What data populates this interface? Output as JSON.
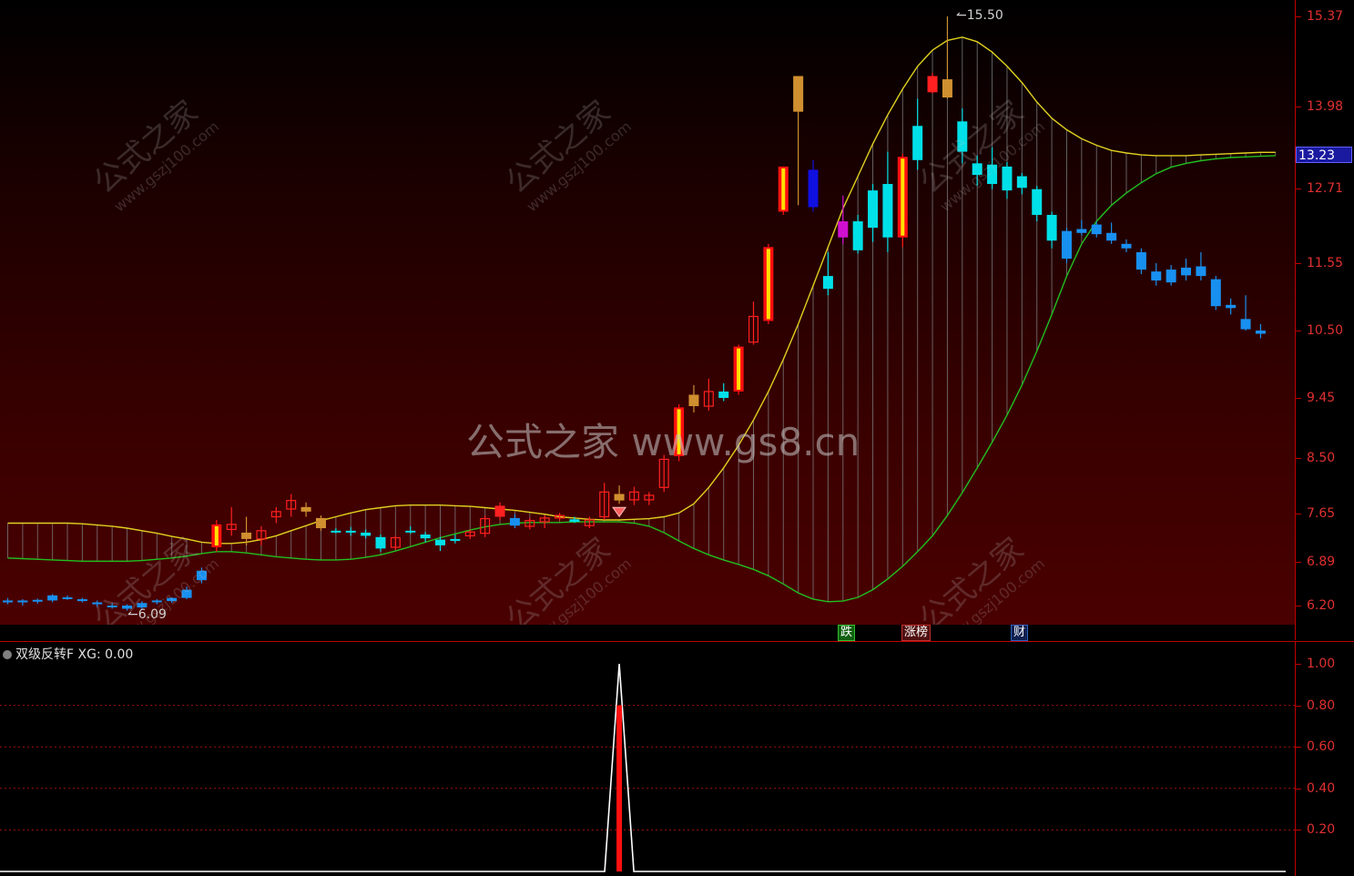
{
  "chart_data": [
    {
      "type": "candlestick",
      "title": "",
      "ylim": [
        6.0,
        15.6
      ],
      "y_ticks": [
        15.37,
        13.98,
        12.71,
        11.55,
        10.5,
        9.45,
        8.5,
        7.65,
        6.89,
        6.2
      ],
      "last_price_label": "13.23",
      "annotations": [
        {
          "text": "15.50",
          "kind": "high"
        },
        {
          "text": "6.09",
          "kind": "low"
        }
      ],
      "candles": [
        {
          "o": 6.28,
          "h": 6.32,
          "l": 6.22,
          "c": 6.25,
          "col": "blue"
        },
        {
          "o": 6.25,
          "h": 6.3,
          "l": 6.2,
          "c": 6.28,
          "col": "blue"
        },
        {
          "o": 6.27,
          "h": 6.31,
          "l": 6.23,
          "c": 6.29,
          "col": "blue"
        },
        {
          "o": 6.36,
          "h": 6.38,
          "l": 6.25,
          "c": 6.28,
          "col": "blue"
        },
        {
          "o": 6.33,
          "h": 6.36,
          "l": 6.29,
          "c": 6.32,
          "col": "blue"
        },
        {
          "o": 6.3,
          "h": 6.32,
          "l": 6.25,
          "c": 6.27,
          "col": "blue"
        },
        {
          "o": 6.25,
          "h": 6.28,
          "l": 6.18,
          "c": 6.22,
          "col": "blue"
        },
        {
          "o": 6.2,
          "h": 6.24,
          "l": 6.15,
          "c": 6.18,
          "col": "blue"
        },
        {
          "o": 6.2,
          "h": 6.22,
          "l": 6.12,
          "c": 6.15,
          "col": "blue"
        },
        {
          "o": 6.24,
          "h": 6.27,
          "l": 6.14,
          "c": 6.17,
          "col": "blue"
        },
        {
          "o": 6.26,
          "h": 6.3,
          "l": 6.22,
          "c": 6.28,
          "col": "blue"
        },
        {
          "o": 6.27,
          "h": 6.33,
          "l": 6.24,
          "c": 6.32,
          "col": "blue"
        },
        {
          "o": 6.45,
          "h": 6.5,
          "l": 6.3,
          "c": 6.32,
          "col": "blue"
        },
        {
          "o": 6.75,
          "h": 6.8,
          "l": 6.55,
          "c": 6.6,
          "col": "blue"
        },
        {
          "o": 7.12,
          "h": 7.55,
          "l": 7.05,
          "c": 7.48,
          "col": "limit"
        },
        {
          "o": 7.4,
          "h": 7.75,
          "l": 7.3,
          "c": 7.48,
          "col": "red"
        },
        {
          "o": 7.35,
          "h": 7.6,
          "l": 7.15,
          "c": 7.25,
          "col": "gold"
        },
        {
          "o": 7.25,
          "h": 7.45,
          "l": 7.15,
          "c": 7.38,
          "col": "red"
        },
        {
          "o": 7.6,
          "h": 7.75,
          "l": 7.5,
          "c": 7.68,
          "col": "red"
        },
        {
          "o": 7.72,
          "h": 7.95,
          "l": 7.6,
          "c": 7.85,
          "col": "red"
        },
        {
          "o": 7.75,
          "h": 7.82,
          "l": 7.6,
          "c": 7.68,
          "col": "gold"
        },
        {
          "o": 7.58,
          "h": 7.62,
          "l": 7.38,
          "c": 7.42,
          "col": "gold"
        },
        {
          "o": 7.38,
          "h": 7.42,
          "l": 7.34,
          "c": 7.37,
          "col": "cyan"
        },
        {
          "o": 7.38,
          "h": 7.44,
          "l": 7.3,
          "c": 7.35,
          "col": "cyan"
        },
        {
          "o": 7.35,
          "h": 7.4,
          "l": 7.26,
          "c": 7.3,
          "col": "cyan"
        },
        {
          "o": 7.28,
          "h": 7.32,
          "l": 7.05,
          "c": 7.1,
          "col": "cyan"
        },
        {
          "o": 7.12,
          "h": 7.3,
          "l": 7.08,
          "c": 7.27,
          "col": "red"
        },
        {
          "o": 7.38,
          "h": 7.45,
          "l": 7.33,
          "c": 7.36,
          "col": "cyan"
        },
        {
          "o": 7.32,
          "h": 7.36,
          "l": 7.2,
          "c": 7.26,
          "col": "cyan"
        },
        {
          "o": 7.24,
          "h": 7.28,
          "l": 7.06,
          "c": 7.15,
          "col": "cyan"
        },
        {
          "o": 7.25,
          "h": 7.32,
          "l": 7.18,
          "c": 7.22,
          "col": "cyan"
        },
        {
          "o": 7.3,
          "h": 7.4,
          "l": 7.25,
          "c": 7.36,
          "col": "red"
        },
        {
          "o": 7.34,
          "h": 7.62,
          "l": 7.28,
          "c": 7.57,
          "col": "red"
        },
        {
          "o": 7.6,
          "h": 7.82,
          "l": 7.55,
          "c": 7.77,
          "col": "redfill"
        },
        {
          "o": 7.58,
          "h": 7.64,
          "l": 7.42,
          "c": 7.46,
          "col": "blue"
        },
        {
          "o": 7.45,
          "h": 7.58,
          "l": 7.4,
          "c": 7.54,
          "col": "red"
        },
        {
          "o": 7.52,
          "h": 7.62,
          "l": 7.42,
          "c": 7.58,
          "col": "red"
        },
        {
          "o": 7.58,
          "h": 7.66,
          "l": 7.54,
          "c": 7.62,
          "col": "red"
        },
        {
          "o": 7.56,
          "h": 7.6,
          "l": 7.5,
          "c": 7.52,
          "col": "cyan"
        },
        {
          "o": 7.46,
          "h": 7.6,
          "l": 7.42,
          "c": 7.55,
          "col": "red"
        },
        {
          "o": 7.6,
          "h": 8.12,
          "l": 7.55,
          "c": 7.98,
          "col": "red"
        },
        {
          "o": 7.95,
          "h": 8.08,
          "l": 7.8,
          "c": 7.85,
          "col": "gold"
        },
        {
          "o": 7.86,
          "h": 8.06,
          "l": 7.78,
          "c": 7.98,
          "col": "red"
        },
        {
          "o": 7.86,
          "h": 7.98,
          "l": 7.78,
          "c": 7.93,
          "col": "red"
        },
        {
          "o": 8.05,
          "h": 8.55,
          "l": 7.98,
          "c": 8.48,
          "col": "red"
        },
        {
          "o": 8.53,
          "h": 9.35,
          "l": 8.45,
          "c": 9.3,
          "col": "limit"
        },
        {
          "o": 9.32,
          "h": 9.65,
          "l": 9.22,
          "c": 9.5,
          "col": "gold"
        },
        {
          "o": 9.32,
          "h": 9.75,
          "l": 9.25,
          "c": 9.55,
          "col": "red"
        },
        {
          "o": 9.55,
          "h": 9.68,
          "l": 9.4,
          "c": 9.45,
          "col": "cyan"
        },
        {
          "o": 9.55,
          "h": 10.28,
          "l": 9.5,
          "c": 10.25,
          "col": "limit"
        },
        {
          "o": 10.32,
          "h": 10.95,
          "l": 10.28,
          "c": 10.72,
          "col": "red"
        },
        {
          "o": 10.65,
          "h": 11.85,
          "l": 10.6,
          "c": 11.8,
          "col": "limit"
        },
        {
          "o": 12.35,
          "h": 13.05,
          "l": 12.3,
          "c": 13.05,
          "col": "limit"
        },
        {
          "o": 13.9,
          "h": 14.45,
          "l": 12.45,
          "c": 14.45,
          "col": "gold"
        },
        {
          "o": 13.0,
          "h": 13.15,
          "l": 12.35,
          "c": 12.42,
          "col": "bluefill"
        },
        {
          "o": 11.15,
          "h": 11.72,
          "l": 11.05,
          "c": 11.35,
          "col": "cyan"
        },
        {
          "o": 12.2,
          "h": 12.6,
          "l": 11.85,
          "c": 11.95,
          "col": "purple"
        },
        {
          "o": 11.75,
          "h": 12.3,
          "l": 11.7,
          "c": 12.2,
          "col": "cyan"
        },
        {
          "o": 12.1,
          "h": 12.78,
          "l": 11.88,
          "c": 12.68,
          "col": "cyan"
        },
        {
          "o": 12.78,
          "h": 13.28,
          "l": 11.72,
          "c": 11.95,
          "col": "cyan"
        },
        {
          "o": 11.95,
          "h": 13.25,
          "l": 11.8,
          "c": 13.2,
          "col": "limit"
        },
        {
          "o": 13.68,
          "h": 14.1,
          "l": 13.0,
          "c": 13.15,
          "col": "cyan"
        },
        {
          "o": 14.2,
          "h": 14.5,
          "l": 14.18,
          "c": 14.45,
          "col": "redfill"
        },
        {
          "o": 14.4,
          "h": 15.5,
          "l": 14.1,
          "c": 14.12,
          "col": "gold"
        },
        {
          "o": 13.75,
          "h": 13.95,
          "l": 13.1,
          "c": 13.28,
          "col": "cyan"
        },
        {
          "o": 13.1,
          "h": 13.22,
          "l": 12.75,
          "c": 12.92,
          "col": "cyan"
        },
        {
          "o": 12.78,
          "h": 13.35,
          "l": 12.7,
          "c": 13.08,
          "col": "cyan"
        },
        {
          "o": 13.05,
          "h": 13.12,
          "l": 12.55,
          "c": 12.68,
          "col": "cyan"
        },
        {
          "o": 12.9,
          "h": 12.95,
          "l": 12.62,
          "c": 12.72,
          "col": "cyan"
        },
        {
          "o": 12.7,
          "h": 12.75,
          "l": 12.2,
          "c": 12.3,
          "col": "cyan"
        },
        {
          "o": 12.3,
          "h": 12.35,
          "l": 11.78,
          "c": 11.9,
          "col": "cyan"
        },
        {
          "o": 12.05,
          "h": 12.1,
          "l": 11.55,
          "c": 11.62,
          "col": "blue"
        },
        {
          "o": 12.08,
          "h": 12.22,
          "l": 11.98,
          "c": 12.02,
          "col": "blue"
        },
        {
          "o": 12.15,
          "h": 12.2,
          "l": 11.95,
          "c": 12.0,
          "col": "blue"
        },
        {
          "o": 12.02,
          "h": 12.18,
          "l": 11.85,
          "c": 11.9,
          "col": "blue"
        },
        {
          "o": 11.85,
          "h": 11.92,
          "l": 11.72,
          "c": 11.78,
          "col": "blue"
        },
        {
          "o": 11.72,
          "h": 11.78,
          "l": 11.38,
          "c": 11.45,
          "col": "blue"
        },
        {
          "o": 11.42,
          "h": 11.55,
          "l": 11.2,
          "c": 11.28,
          "col": "blue"
        },
        {
          "o": 11.45,
          "h": 11.52,
          "l": 11.2,
          "c": 11.25,
          "col": "blue"
        },
        {
          "o": 11.48,
          "h": 11.62,
          "l": 11.28,
          "c": 11.36,
          "col": "blue"
        },
        {
          "o": 11.5,
          "h": 11.72,
          "l": 11.28,
          "c": 11.35,
          "col": "blue"
        },
        {
          "o": 11.3,
          "h": 11.35,
          "l": 10.82,
          "c": 10.88,
          "col": "blue"
        },
        {
          "o": 10.9,
          "h": 11.0,
          "l": 10.75,
          "c": 10.85,
          "col": "blue"
        },
        {
          "o": 10.68,
          "h": 11.05,
          "l": 10.5,
          "c": 10.52,
          "col": "blue"
        },
        {
          "o": 10.5,
          "h": 10.6,
          "l": 10.38,
          "c": 10.45,
          "col": "blue"
        }
      ],
      "upper_band": [
        7.5,
        7.5,
        7.5,
        7.5,
        7.5,
        7.49,
        7.47,
        7.45,
        7.42,
        7.38,
        7.34,
        7.29,
        7.25,
        7.2,
        7.18,
        7.18,
        7.2,
        7.24,
        7.3,
        7.38,
        7.46,
        7.54,
        7.6,
        7.66,
        7.71,
        7.74,
        7.77,
        7.78,
        7.78,
        7.78,
        7.77,
        7.76,
        7.74,
        7.72,
        7.7,
        7.67,
        7.64,
        7.6,
        7.58,
        7.56,
        7.55,
        7.55,
        7.56,
        7.57,
        7.6,
        7.66,
        7.8,
        8.05,
        8.35,
        8.7,
        9.1,
        9.55,
        10.05,
        10.6,
        11.2,
        11.8,
        12.4,
        12.9,
        13.4,
        13.85,
        14.25,
        14.6,
        14.85,
        15.0,
        15.05,
        14.98,
        14.82,
        14.6,
        14.35,
        14.05,
        13.8,
        13.62,
        13.48,
        13.38,
        13.3,
        13.26,
        13.23,
        13.22,
        13.22,
        13.22,
        13.23,
        13.24,
        13.25,
        13.26,
        13.27,
        13.27
      ],
      "lower_band": [
        6.95,
        6.94,
        6.93,
        6.92,
        6.91,
        6.9,
        6.9,
        6.9,
        6.9,
        6.91,
        6.93,
        6.95,
        6.98,
        7.02,
        7.05,
        7.05,
        7.03,
        7.0,
        6.97,
        6.95,
        6.93,
        6.92,
        6.92,
        6.93,
        6.96,
        7.0,
        7.06,
        7.13,
        7.2,
        7.27,
        7.33,
        7.39,
        7.44,
        7.48,
        7.5,
        7.51,
        7.51,
        7.51,
        7.52,
        7.52,
        7.52,
        7.52,
        7.5,
        7.45,
        7.35,
        7.22,
        7.1,
        7.0,
        6.92,
        6.85,
        6.77,
        6.67,
        6.54,
        6.4,
        6.3,
        6.26,
        6.27,
        6.33,
        6.45,
        6.62,
        6.82,
        7.05,
        7.3,
        7.62,
        7.97,
        8.35,
        8.75,
        9.18,
        9.65,
        10.18,
        10.75,
        11.35,
        11.85,
        12.2,
        12.45,
        12.64,
        12.8,
        12.94,
        13.04,
        13.1,
        13.14,
        13.17,
        13.19,
        13.2,
        13.21,
        13.22
      ]
    },
    {
      "type": "line",
      "title": "双级反转F",
      "value_label": "XG: 0.00",
      "ylim": [
        0,
        1.0
      ],
      "y_ticks": [
        1.0,
        0.8,
        0.6,
        0.4,
        0.2
      ],
      "y_tick_labels": [
        "1.00",
        "0.80",
        "0.60",
        "0.40",
        "0.20"
      ],
      "signal_index": 41,
      "signal_value": 1.0,
      "bar_value": 0.8
    }
  ],
  "tags": {
    "die": "跌",
    "zhangbang": "涨榜",
    "cai": "财"
  },
  "watermarks": {
    "center": "公式之家 www.gs8.cn",
    "logo": "公式之家",
    "site": "www.gszj100.com"
  },
  "colors": {
    "upper_band": "#e0d020",
    "lower_band": "#20c020",
    "fill_lines": "#808080",
    "limit": "#ff1010",
    "limit_core": "#ffe000",
    "red": "#ff2020",
    "gold": "#d09030",
    "cyan": "#00e0e8",
    "blue": "#1890f0",
    "bluefill": "#1010e0",
    "purple": "#d010d0",
    "axis": "#c00000",
    "axis_text": "#e03030"
  }
}
